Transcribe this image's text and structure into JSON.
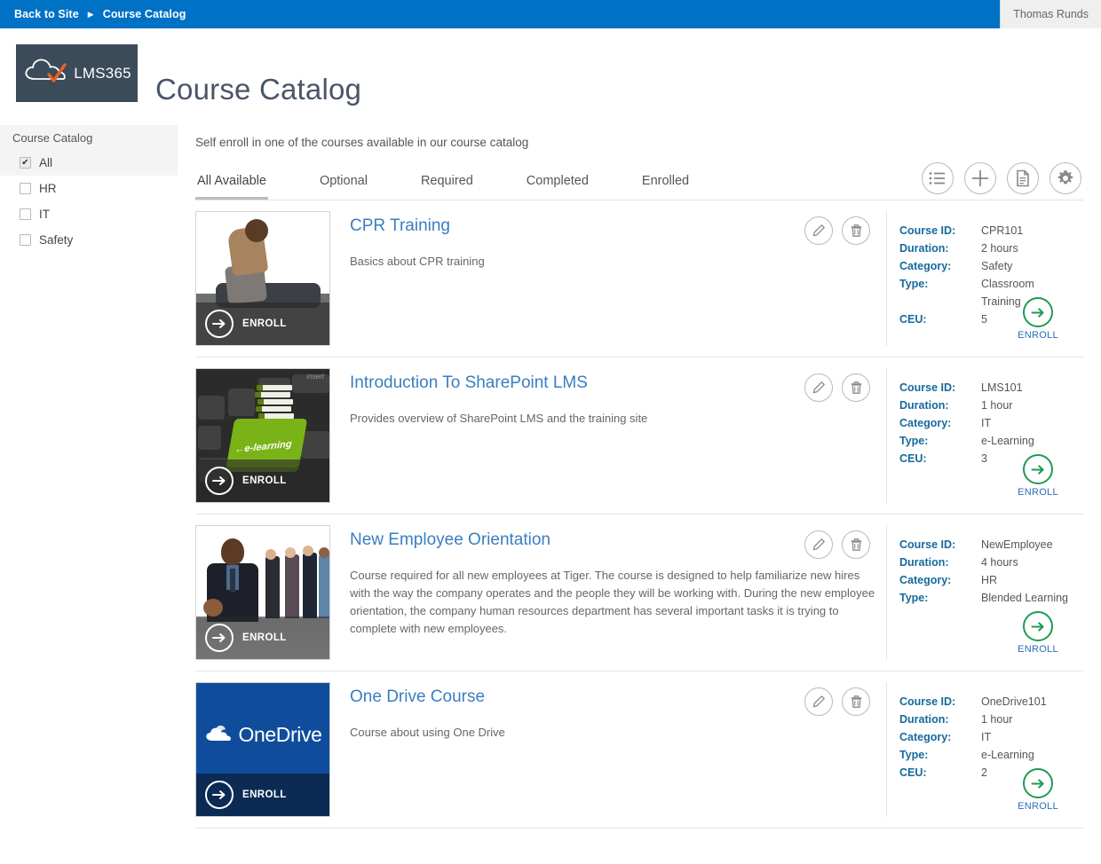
{
  "suitebar": {
    "back_label": "Back to Site",
    "separator": "▶",
    "current_label": "Course Catalog",
    "user_name": "Thomas Runds"
  },
  "header": {
    "logo_text": "LMS365",
    "page_title": "Course Catalog"
  },
  "sidebar": {
    "heading": "Course Catalog",
    "items": [
      {
        "label": "All",
        "checked": true
      },
      {
        "label": "HR",
        "checked": false
      },
      {
        "label": "IT",
        "checked": false
      },
      {
        "label": "Safety",
        "checked": false
      }
    ]
  },
  "main": {
    "intro": "Self enroll in one of the courses available in our course catalog",
    "tabs": [
      {
        "label": "All Available",
        "active": true
      },
      {
        "label": "Optional",
        "active": false
      },
      {
        "label": "Required",
        "active": false
      },
      {
        "label": "Completed",
        "active": false
      },
      {
        "label": "Enrolled",
        "active": false
      }
    ],
    "toolbar": [
      {
        "name": "list-view-icon",
        "glyph": "list"
      },
      {
        "name": "add-course-icon",
        "glyph": "plus"
      },
      {
        "name": "report-icon",
        "glyph": "document"
      },
      {
        "name": "settings-icon",
        "glyph": "gear"
      }
    ],
    "row_actions": {
      "edit_label": "Edit",
      "delete_label": "Delete"
    },
    "enroll_label": "ENROLL",
    "meta_keys": {
      "course_id": "Course ID:",
      "duration": "Duration:",
      "category": "Category:",
      "type": "Type:",
      "ceu": "CEU:"
    }
  },
  "courses": [
    {
      "title": "CPR Training",
      "description": "Basics about CPR training",
      "thumb": "cpr-training-thumbnail",
      "course_id": "CPR101",
      "duration": "2 hours",
      "category": "Safety",
      "type": "Classroom Training",
      "ceu": "5"
    },
    {
      "title": "Introduction To SharePoint LMS",
      "description": "Provides overview of SharePoint LMS and the training site",
      "thumb": "e-learning-keyboard-thumbnail",
      "course_id": "LMS101",
      "duration": "1 hour",
      "category": "IT",
      "type": "e-Learning",
      "ceu": "3"
    },
    {
      "title": "New Employee Orientation",
      "description": "Course required for all new employees at Tiger. The course is designed to help familiarize new hires with the way the company operates and the people they will be working with. During the new employee orientation, the company human resources department has several important tasks it is trying to complete with new employees.",
      "thumb": "new-employees-thumbnail",
      "course_id": "NewEmployee",
      "duration": "4 hours",
      "category": "HR",
      "type": "Blended Learning",
      "ceu": ""
    },
    {
      "title": "One Drive Course",
      "description": "Course about using One Drive",
      "thumb": "onedrive-thumbnail",
      "course_id": "OneDrive101",
      "duration": "1 hour",
      "category": "IT",
      "type": "e-Learning",
      "ceu": "2"
    }
  ],
  "colors": {
    "suitebar_blue": "#0072c6",
    "title_link_blue": "#3a7ec0",
    "meta_key_blue": "#16699c",
    "enroll_green": "#1f9a52",
    "logo_bg": "#3b4b5a",
    "onedrive_blue": "#0f4c9c"
  }
}
